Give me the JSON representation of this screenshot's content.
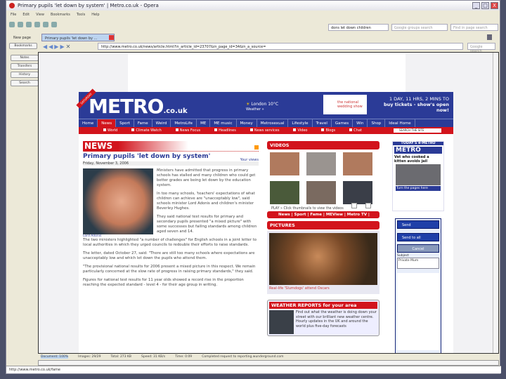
{
  "window": {
    "title": "Primary pupils 'let down by system' | Metro.co.uk - Opera",
    "minimize": "_",
    "maximize": "□",
    "close": "X"
  },
  "menu": [
    "File",
    "Edit",
    "View",
    "Bookmarks",
    "Tools",
    "Help"
  ],
  "search": {
    "phrase": "dons let down children",
    "groups_placeholder": "Google groups search",
    "find_placeholder": "Find in page search",
    "google_placeholder": "Google search"
  },
  "tabs": [
    {
      "label": "New page"
    },
    {
      "label": "Primary pupils 'let down by ..."
    }
  ],
  "address": {
    "url": "http://www.metro.co.uk/news/article.html?in_article_id=23707&in_page_id=34&in_a_source="
  },
  "panel": [
    "Bookmarks",
    "Notes",
    "Transfers",
    "History",
    "Search"
  ],
  "metro": {
    "badge": "SATURDAY",
    "logo": "METRO",
    "logo_suffix": ".co.uk",
    "weather": "London 10°C",
    "weather_sub": "Weather »",
    "ad_brand": "the national wedding show",
    "ad_line1": "1 DAY, 11 HRS, 2 MINS TO",
    "ad_line2": "buy tickets - show's open now!",
    "nav": [
      "Home",
      "News",
      "Sport",
      "Fame",
      "Weird",
      "MetroLife",
      "ME",
      "ME music",
      "Money",
      "Metrosexual",
      "Lifestyle",
      "Travel",
      "Games",
      "Win",
      "Shop",
      "Ideal Home"
    ],
    "subnav": [
      "World",
      "Climate Watch",
      "News Focus",
      "Headlines",
      "News services",
      "Video",
      "Blogs",
      "Chat"
    ],
    "search_label": "SEARCH THE SITE"
  },
  "article": {
    "section": "NEWS",
    "headline": "Primary pupils 'let down by system'",
    "your_views": "Your views",
    "date": "Friday, November 3, 2006",
    "caption": "Lord Adonis",
    "paragraphs": [
      "Ministers have admitted that progress in primary schools has stalled and many children who could get better grades are being let down by the education system.",
      "In too many schools, 'teachers' expectations of what children can achieve are \"unacceptably low\", said schools minister Lord Adonis and children's minister Beverley Hughes.",
      "They said national test results for primary and secondary pupils presented \"a mixed picture\" with some successes but failing standards among children aged seven and 14.",
      "The two ministers highlighted \"a number of challenges\" for English schools in a joint letter to local authorities in which they urged councils to redouble their efforts to raise standards.",
      "The letter, dated October 27, said: \"There are still too many schools where expectations are unacceptably low and which let down the pupils who attend them.",
      "\"The provisional national results for 2006 present a mixed picture in this respect. We remain particularly concerned at the slow rate of progress in raising primary standards,\" they said.",
      "Figures for national test results for 11 year olds showed a record rise in the proportion reaching the expected standard - level 4 - for their age group in writing."
    ]
  },
  "videos": {
    "title": "VIDEOS",
    "play": "PLAY » Click thumbnails to view the videos",
    "links": "News | Sport | Fame | MEView | Metro TV |"
  },
  "pictures": {
    "title": "PICTURES",
    "caption": "Real-life 'Slumdogs' attend Oscars"
  },
  "weather": {
    "title": "WEATHER REPORTS for your area",
    "text": "Find out what the weather is doing down your street with our brilliant new weather centre. Hourly updates in the UK and around the world plus five-day forecasts"
  },
  "emetro": {
    "title": "TODAY'S e-METRO",
    "headline": "Vet who cooked a kitten avoids jail",
    "cta": "Turn the pages here"
  },
  "sendform": {
    "send": "Send",
    "send_all": "Send to all",
    "cancel": "Cancel",
    "subject_label": "Subject",
    "subject_value": "Private Mum"
  },
  "status": {
    "document": "Document: 100%",
    "images": "Images: 29/29",
    "total": "Total: 273 KB",
    "speed": "Speed: 31 KB/s",
    "time": "Time: 0:09",
    "message": "Completed request to reporting.wunderground.com"
  },
  "hover_url": "http://www.metro.co.uk/fame"
}
